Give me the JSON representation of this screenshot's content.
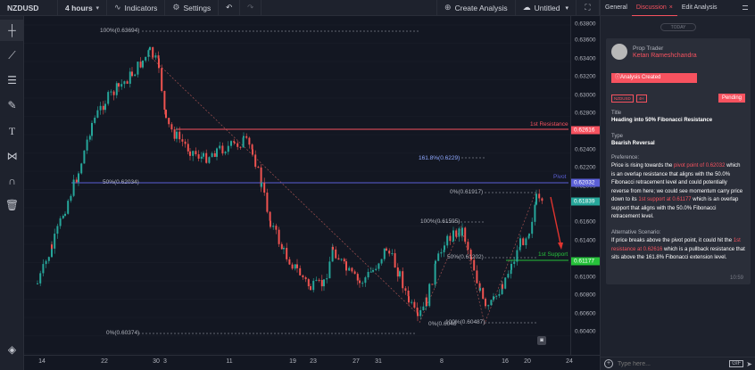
{
  "toolbar": {
    "symbol": "NZDUSD",
    "interval": "4 hours",
    "indicators": "Indicators",
    "settings": "Settings",
    "create_analysis": "Create Analysis",
    "layout_name": "Untitled"
  },
  "left_tools": [
    "crosshair-icon",
    "trend-line-icon",
    "fib-icon",
    "brush-icon",
    "text-icon",
    "pattern-icon",
    "magnet-icon",
    "trash-icon",
    "layers-icon"
  ],
  "price_axis": {
    "ticks": [
      "0.63800",
      "0.63600",
      "0.63400",
      "0.63200",
      "0.63000",
      "0.62800",
      "0.62400",
      "0.62200",
      "0.62000",
      "0.61600",
      "0.61400",
      "0.61000",
      "0.60800",
      "0.60600",
      "0.60400"
    ],
    "tags": [
      {
        "text": "0.62616",
        "color": "#f7525f"
      },
      {
        "text": "0.62032",
        "color": "#5b5fd6"
      },
      {
        "text": "0.61839",
        "color": "#26a69a"
      },
      {
        "text": "0.61177",
        "color": "#26c23a"
      }
    ]
  },
  "time_axis": [
    "14",
    "22",
    "30",
    "3",
    "11",
    "19",
    "23",
    "27",
    "31",
    "8",
    "16",
    "20",
    "24"
  ],
  "chart_labels": {
    "fib_top": "100%(0.63694)",
    "fib_mid": "50%(0.62034)",
    "fib_bottom": "0%(0.60374)",
    "resistance": "1st Resistance",
    "pivot": "Pivot",
    "support": "1st Support",
    "ext_1618": "161.8%(0.6229)",
    "fib2_0": "0%(0.61917)",
    "fib2_100": "100%(0.61595)",
    "fib2_50": "50%(0.61202)",
    "fib2_low": "100%(0.60487)",
    "fib2_low_left": "0%(0.6048"
  },
  "panel": {
    "tabs": [
      "General",
      "Discussion",
      "Edit Analysis"
    ],
    "active_tab": "Discussion",
    "today": "TODAY",
    "role": "Prop Trader",
    "user": "Ketan Rameshchandra",
    "created": "Analysis Created",
    "tags": [
      "NZDUSD",
      "4H"
    ],
    "status": "Pending",
    "title_label": "Title",
    "title": "Heading into 50% Fibonacci Resistance",
    "type_label": "Type",
    "type": "Bearish Reversal",
    "pref_label": "Preference:",
    "pref_1": "Price is rising towards the ",
    "pref_hl1": "pivot point of 0.62032",
    "pref_2": " which is an overlap resistance that aligns with the 50.0% Fibonacci retracement level and could potentially reverse from here; we could see momentum carry price down to its ",
    "pref_hl2": "1st support at 0.61177",
    "pref_3": " which is an overlap support that aligns with the 50.0% Fibonacci retracement level.",
    "alt_label": "Alternative Scenario:",
    "alt_1": "If price breaks above the pivot point, it could hit the ",
    "alt_hl": "1st resistance at 0.62616",
    "alt_2": " which is a pullback resistance that sits above the 161.8% Fibonacci extension level.",
    "time": "10:59",
    "input_placeholder": "Type here...",
    "gif": "GIF"
  }
}
